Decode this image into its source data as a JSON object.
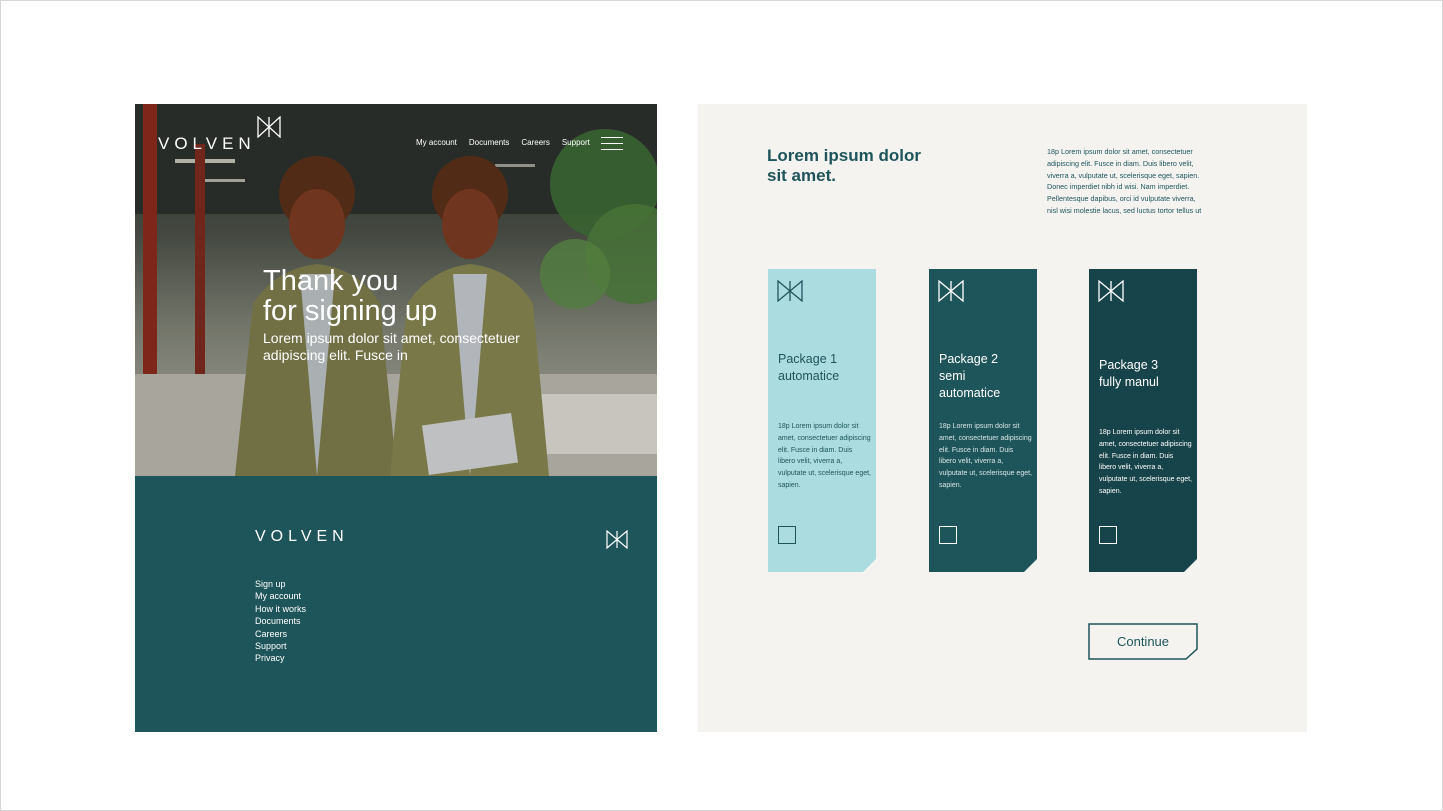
{
  "brand": {
    "name": "VOLVEN",
    "primary_color": "#1e555b",
    "light_teal": "#abdce0",
    "dark_teal": "#17444a",
    "background": "#f4f3f0"
  },
  "header": {
    "nav": [
      "My account",
      "Documents",
      "Careers",
      "Support"
    ],
    "menu_icon": "hamburger-icon"
  },
  "hero": {
    "title_line1": "Thank you",
    "title_line2": "for signing up",
    "subtitle": "Lorem ipsum dolor sit amet, consectetuer adipiscing elit. Fusce in"
  },
  "footer": {
    "logo": "VOLVEN",
    "links": [
      "Sign up",
      "My account",
      "How it works",
      "Documents",
      "Careers",
      "Support",
      "Privacy"
    ]
  },
  "packages_section": {
    "heading": "Lorem ipsum dolor sit amet.",
    "body": "18p Lorem ipsum dolor sit amet, consectetuer adipiscing elit. Fusce in diam. Duis libero velit, viverra a, vulputate ut, scelerisque eget, sapien. Donec imperdiet nibh id wisi. Nam imperdiet. Pellentesque dapibus, orci id vulputate viverra, nisl wisi molestie lacus, sed luctus tortor tellus ut",
    "packages": [
      {
        "title_line1": "Package 1",
        "title_line2": "automatice",
        "title_line3": "",
        "description": "18p Lorem ipsum dolor sit amet, consectetuer adipiscing elit. Fusce in diam. Duis libero velit, viverra a, vulputate ut, scelerisque eget, sapien."
      },
      {
        "title_line1": "Package 2",
        "title_line2": "semi",
        "title_line3": "automatice",
        "description": "18p Lorem ipsum dolor sit amet, consectetuer adipiscing elit. Fusce in diam. Duis libero velit, viverra a, vulputate ut, scelerisque eget, sapien."
      },
      {
        "title_line1": "Package 3",
        "title_line2": "fully manul",
        "title_line3": "",
        "description": "18p Lorem ipsum dolor sit amet, consectetuer adipiscing elit. Fusce in diam. Duis libero velit, viverra a, vulputate ut, scelerisque eget, sapien."
      }
    ],
    "continue_label": "Continue"
  }
}
